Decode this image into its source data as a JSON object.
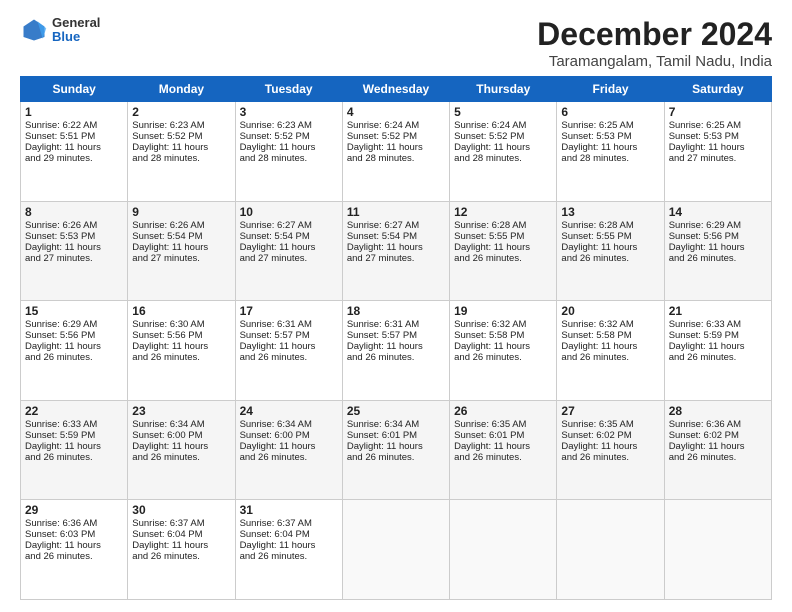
{
  "header": {
    "logo_general": "General",
    "logo_blue": "Blue",
    "main_title": "December 2024",
    "subtitle": "Taramangalam, Tamil Nadu, India"
  },
  "days_of_week": [
    "Sunday",
    "Monday",
    "Tuesday",
    "Wednesday",
    "Thursday",
    "Friday",
    "Saturday"
  ],
  "weeks": [
    [
      {
        "day": "1",
        "info": "Sunrise: 6:22 AM\nSunset: 5:51 PM\nDaylight: 11 hours\nand 29 minutes."
      },
      {
        "day": "2",
        "info": "Sunrise: 6:23 AM\nSunset: 5:52 PM\nDaylight: 11 hours\nand 28 minutes."
      },
      {
        "day": "3",
        "info": "Sunrise: 6:23 AM\nSunset: 5:52 PM\nDaylight: 11 hours\nand 28 minutes."
      },
      {
        "day": "4",
        "info": "Sunrise: 6:24 AM\nSunset: 5:52 PM\nDaylight: 11 hours\nand 28 minutes."
      },
      {
        "day": "5",
        "info": "Sunrise: 6:24 AM\nSunset: 5:52 PM\nDaylight: 11 hours\nand 28 minutes."
      },
      {
        "day": "6",
        "info": "Sunrise: 6:25 AM\nSunset: 5:53 PM\nDaylight: 11 hours\nand 28 minutes."
      },
      {
        "day": "7",
        "info": "Sunrise: 6:25 AM\nSunset: 5:53 PM\nDaylight: 11 hours\nand 27 minutes."
      }
    ],
    [
      {
        "day": "8",
        "info": "Sunrise: 6:26 AM\nSunset: 5:53 PM\nDaylight: 11 hours\nand 27 minutes."
      },
      {
        "day": "9",
        "info": "Sunrise: 6:26 AM\nSunset: 5:54 PM\nDaylight: 11 hours\nand 27 minutes."
      },
      {
        "day": "10",
        "info": "Sunrise: 6:27 AM\nSunset: 5:54 PM\nDaylight: 11 hours\nand 27 minutes."
      },
      {
        "day": "11",
        "info": "Sunrise: 6:27 AM\nSunset: 5:54 PM\nDaylight: 11 hours\nand 27 minutes."
      },
      {
        "day": "12",
        "info": "Sunrise: 6:28 AM\nSunset: 5:55 PM\nDaylight: 11 hours\nand 26 minutes."
      },
      {
        "day": "13",
        "info": "Sunrise: 6:28 AM\nSunset: 5:55 PM\nDaylight: 11 hours\nand 26 minutes."
      },
      {
        "day": "14",
        "info": "Sunrise: 6:29 AM\nSunset: 5:56 PM\nDaylight: 11 hours\nand 26 minutes."
      }
    ],
    [
      {
        "day": "15",
        "info": "Sunrise: 6:29 AM\nSunset: 5:56 PM\nDaylight: 11 hours\nand 26 minutes."
      },
      {
        "day": "16",
        "info": "Sunrise: 6:30 AM\nSunset: 5:56 PM\nDaylight: 11 hours\nand 26 minutes."
      },
      {
        "day": "17",
        "info": "Sunrise: 6:31 AM\nSunset: 5:57 PM\nDaylight: 11 hours\nand 26 minutes."
      },
      {
        "day": "18",
        "info": "Sunrise: 6:31 AM\nSunset: 5:57 PM\nDaylight: 11 hours\nand 26 minutes."
      },
      {
        "day": "19",
        "info": "Sunrise: 6:32 AM\nSunset: 5:58 PM\nDaylight: 11 hours\nand 26 minutes."
      },
      {
        "day": "20",
        "info": "Sunrise: 6:32 AM\nSunset: 5:58 PM\nDaylight: 11 hours\nand 26 minutes."
      },
      {
        "day": "21",
        "info": "Sunrise: 6:33 AM\nSunset: 5:59 PM\nDaylight: 11 hours\nand 26 minutes."
      }
    ],
    [
      {
        "day": "22",
        "info": "Sunrise: 6:33 AM\nSunset: 5:59 PM\nDaylight: 11 hours\nand 26 minutes."
      },
      {
        "day": "23",
        "info": "Sunrise: 6:34 AM\nSunset: 6:00 PM\nDaylight: 11 hours\nand 26 minutes."
      },
      {
        "day": "24",
        "info": "Sunrise: 6:34 AM\nSunset: 6:00 PM\nDaylight: 11 hours\nand 26 minutes."
      },
      {
        "day": "25",
        "info": "Sunrise: 6:34 AM\nSunset: 6:01 PM\nDaylight: 11 hours\nand 26 minutes."
      },
      {
        "day": "26",
        "info": "Sunrise: 6:35 AM\nSunset: 6:01 PM\nDaylight: 11 hours\nand 26 minutes."
      },
      {
        "day": "27",
        "info": "Sunrise: 6:35 AM\nSunset: 6:02 PM\nDaylight: 11 hours\nand 26 minutes."
      },
      {
        "day": "28",
        "info": "Sunrise: 6:36 AM\nSunset: 6:02 PM\nDaylight: 11 hours\nand 26 minutes."
      }
    ],
    [
      {
        "day": "29",
        "info": "Sunrise: 6:36 AM\nSunset: 6:03 PM\nDaylight: 11 hours\nand 26 minutes."
      },
      {
        "day": "30",
        "info": "Sunrise: 6:37 AM\nSunset: 6:04 PM\nDaylight: 11 hours\nand 26 minutes."
      },
      {
        "day": "31",
        "info": "Sunrise: 6:37 AM\nSunset: 6:04 PM\nDaylight: 11 hours\nand 26 minutes."
      },
      {
        "day": "",
        "info": ""
      },
      {
        "day": "",
        "info": ""
      },
      {
        "day": "",
        "info": ""
      },
      {
        "day": "",
        "info": ""
      }
    ]
  ]
}
